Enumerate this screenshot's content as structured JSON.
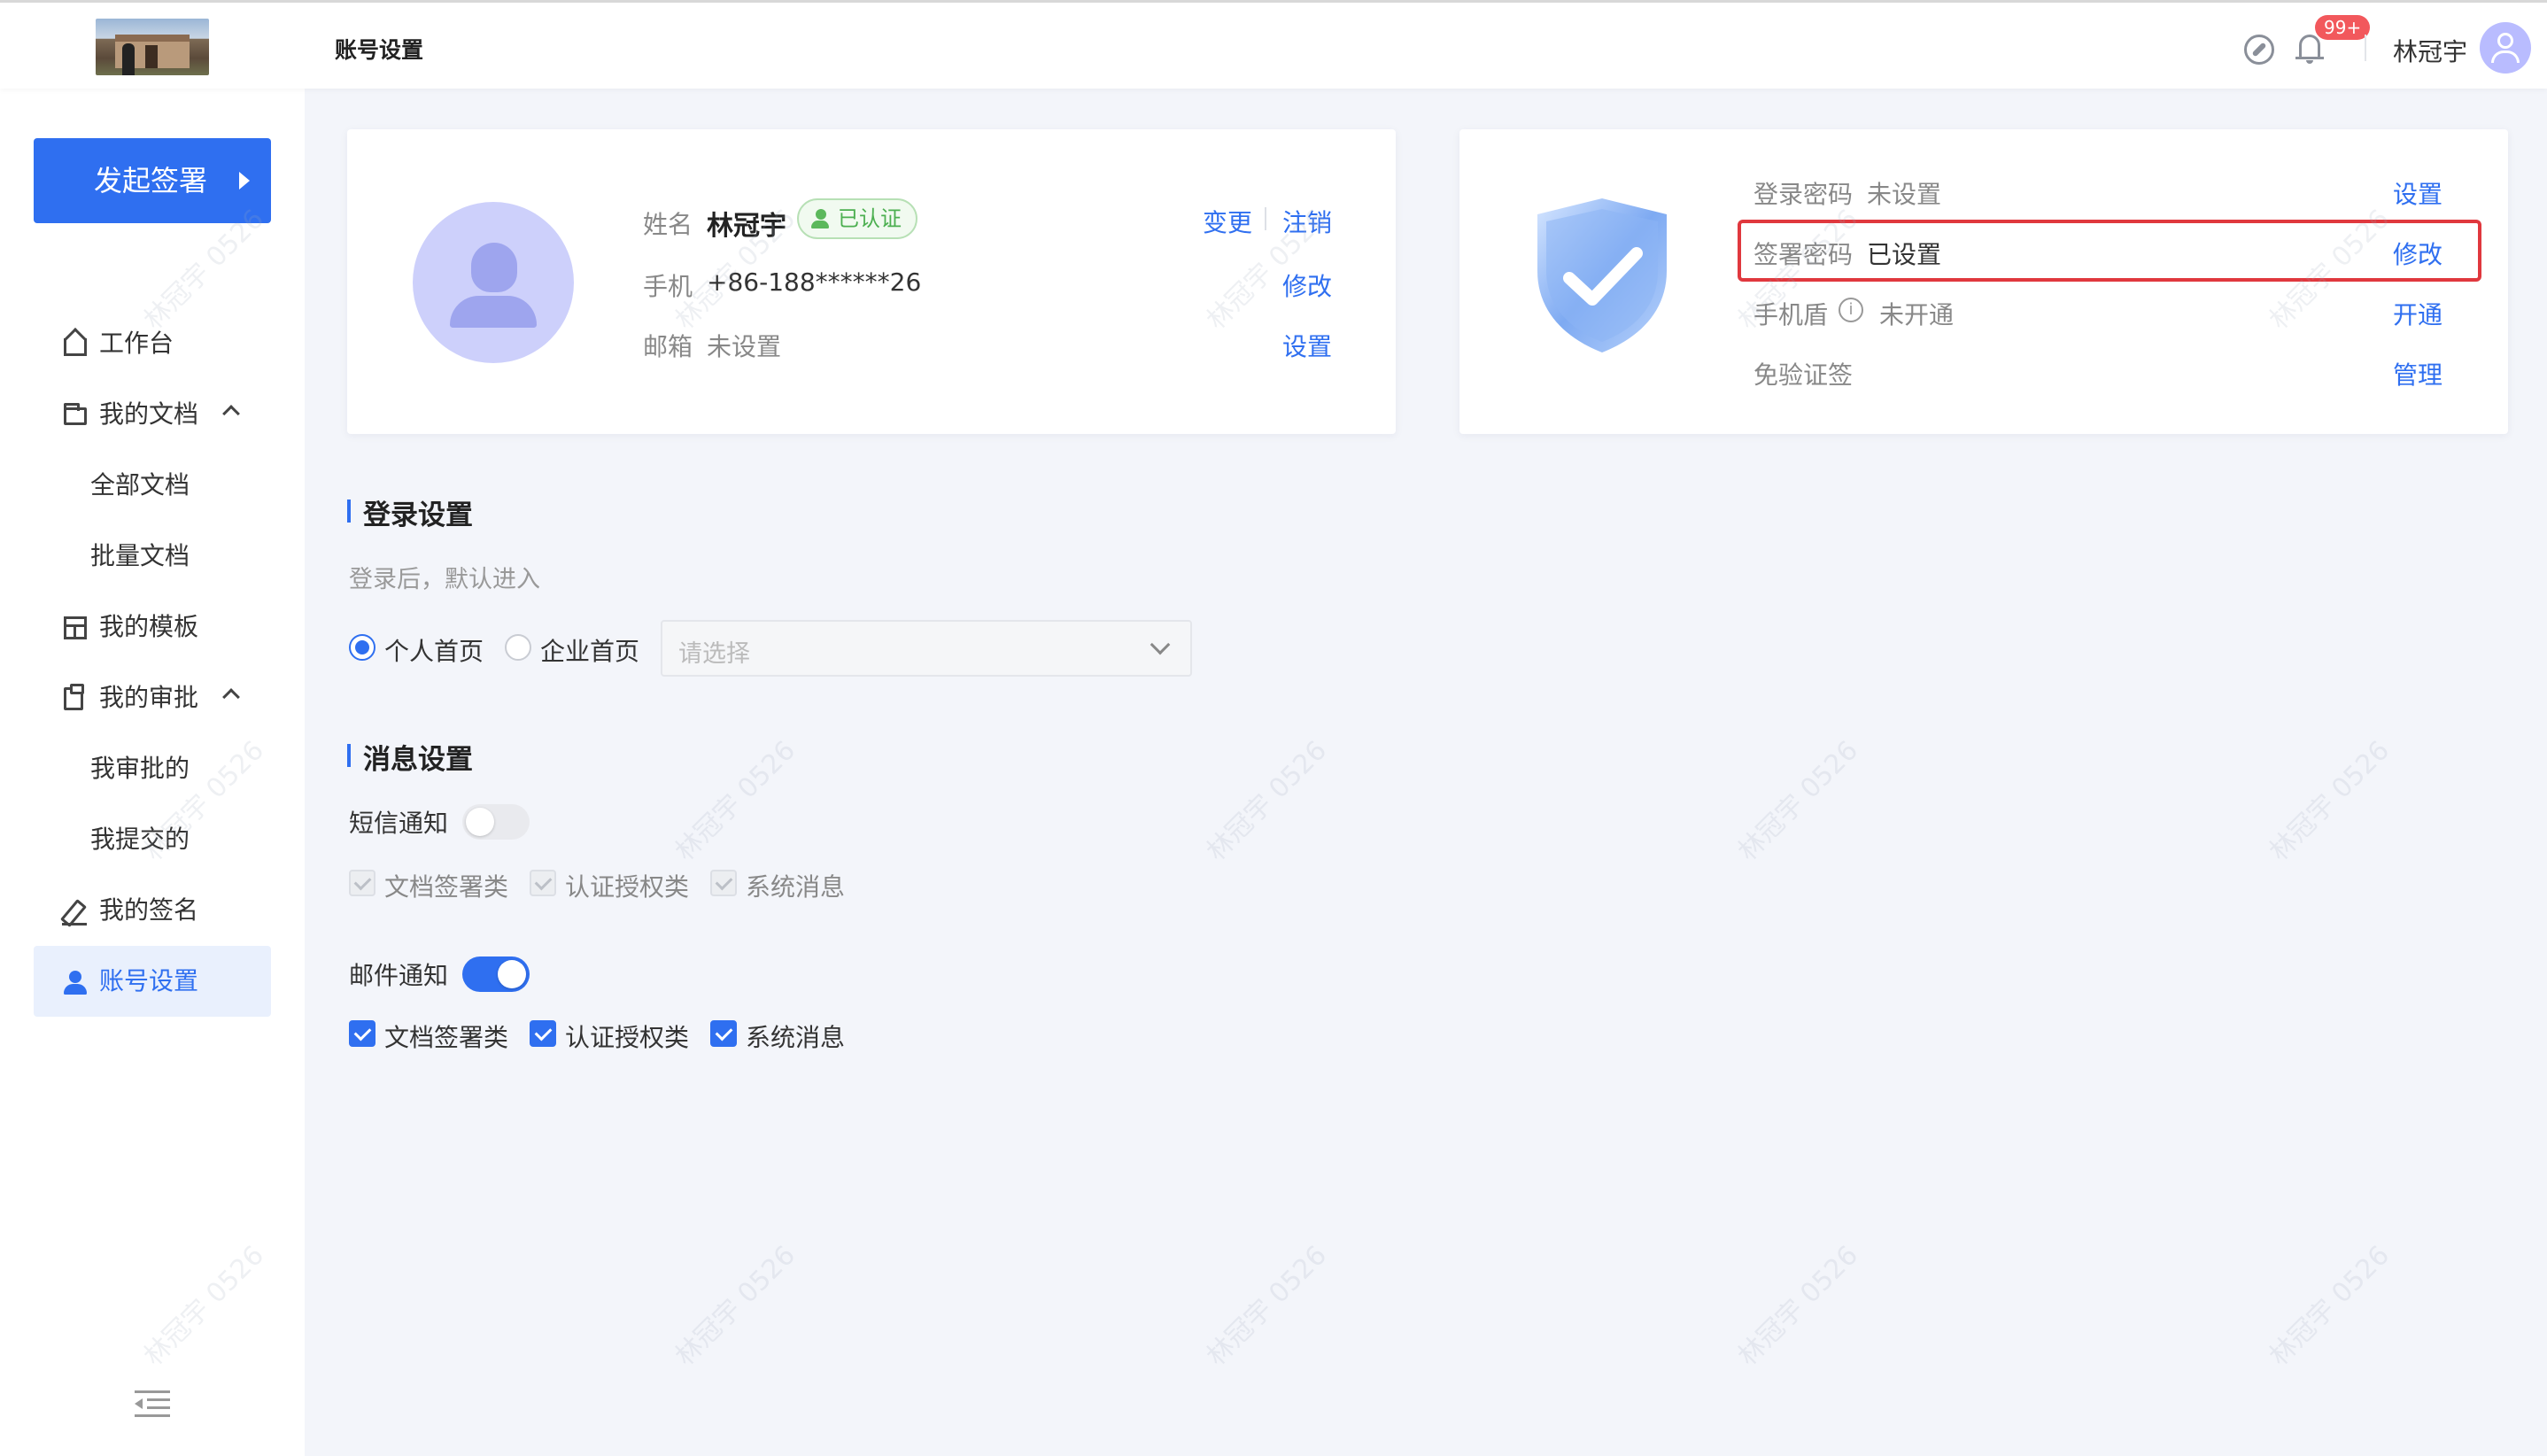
{
  "header": {
    "title": "账号设置",
    "badge": "99+",
    "user_name": "林冠宇"
  },
  "sidebar": {
    "start_button": "发起签署",
    "items": [
      {
        "label": "工作台"
      },
      {
        "label": "我的文档"
      },
      {
        "label": "全部文档"
      },
      {
        "label": "批量文档"
      },
      {
        "label": "我的模板"
      },
      {
        "label": "我的审批"
      },
      {
        "label": "我审批的"
      },
      {
        "label": "我提交的"
      },
      {
        "label": "我的签名"
      },
      {
        "label": "账号设置"
      }
    ]
  },
  "profile": {
    "name_label": "姓名",
    "name_value": "林冠宇",
    "verified": "已认证",
    "change_link": "变更",
    "cancel_link": "注销",
    "phone_label": "手机",
    "phone_value": "+86-188******26",
    "phone_action": "修改",
    "email_label": "邮箱",
    "email_value": "未设置",
    "email_action": "设置"
  },
  "security": {
    "rows": [
      {
        "label": "登录密码",
        "value": "未设置",
        "action": "设置"
      },
      {
        "label": "签署密码",
        "value": "已设置",
        "action": "修改"
      },
      {
        "label": "手机盾",
        "value": "未开通",
        "action": "开通"
      },
      {
        "label": "免验证签",
        "value": "",
        "action": "管理"
      }
    ],
    "info_glyph": "i"
  },
  "login_settings": {
    "title": "登录设置",
    "desc": "登录后，默认进入",
    "option_personal": "个人首页",
    "option_company": "企业首页",
    "select_placeholder": "请选择",
    "selected": "个人首页"
  },
  "message_settings": {
    "title": "消息设置",
    "sms": {
      "label": "短信通知",
      "enabled": false,
      "checks": [
        "文档签署类",
        "认证授权类",
        "系统消息"
      ]
    },
    "email": {
      "label": "邮件通知",
      "enabled": true,
      "checks": [
        "文档签署类",
        "认证授权类",
        "系统消息"
      ]
    }
  },
  "watermark": "林冠宇 0526",
  "colors": {
    "accent": "#2f6ff0",
    "highlight_border": "#e0383e",
    "verified_green": "#4caf50",
    "badge_red": "#f2585c"
  }
}
